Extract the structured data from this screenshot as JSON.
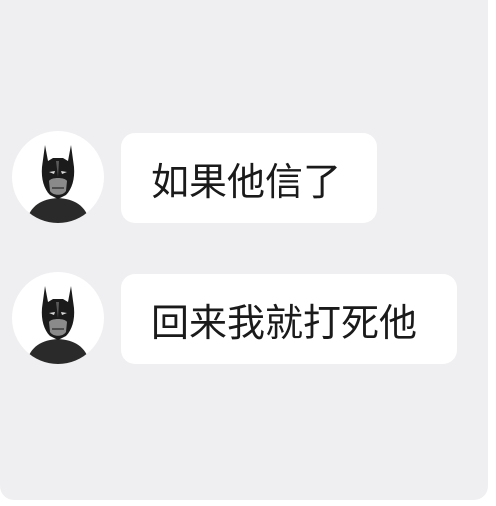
{
  "messages": [
    {
      "avatar_icon": "batman-avatar-icon",
      "text": "如果他信了"
    },
    {
      "avatar_icon": "batman-avatar-icon",
      "text": "回来我就打死他"
    }
  ],
  "colors": {
    "background": "#efeff1",
    "bubble": "#ffffff",
    "text": "#1a1a1a"
  }
}
